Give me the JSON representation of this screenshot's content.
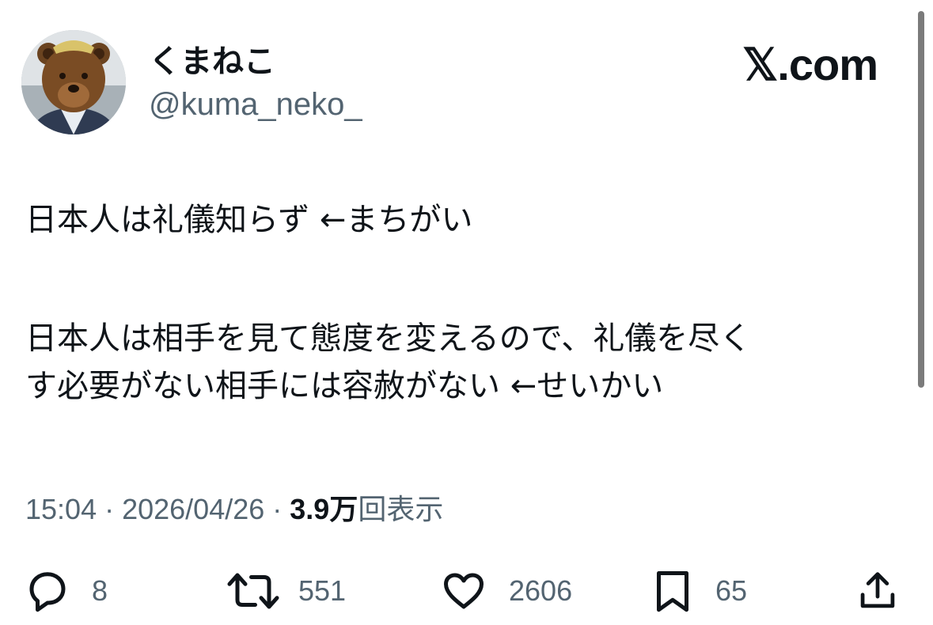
{
  "user": {
    "display_name": "くまねこ",
    "handle": "@kuma_neko_"
  },
  "brand": "𝕏.com",
  "tweet": {
    "line1": "日本人は礼儀知らず ←まちがい",
    "line2": "日本人は相手を見て態度を変えるので、礼儀を尽く",
    "line3": "す必要がない相手には容赦がない ←せいかい"
  },
  "meta": {
    "time": "15:04",
    "separator1": " · ",
    "date": "2026/04/26",
    "separator2": " · ",
    "views_count": "3.9万",
    "views_label": "回表示"
  },
  "actions": {
    "reply": {
      "icon": "reply-icon",
      "count": "8"
    },
    "retweet": {
      "icon": "retweet-icon",
      "count": "551"
    },
    "like": {
      "icon": "heart-icon",
      "count": "2606"
    },
    "bookmark": {
      "icon": "bookmark-icon",
      "count": "65"
    },
    "share": {
      "icon": "share-icon"
    }
  },
  "colors": {
    "text": "#0f1419",
    "secondary": "#536471",
    "background": "#ffffff"
  }
}
